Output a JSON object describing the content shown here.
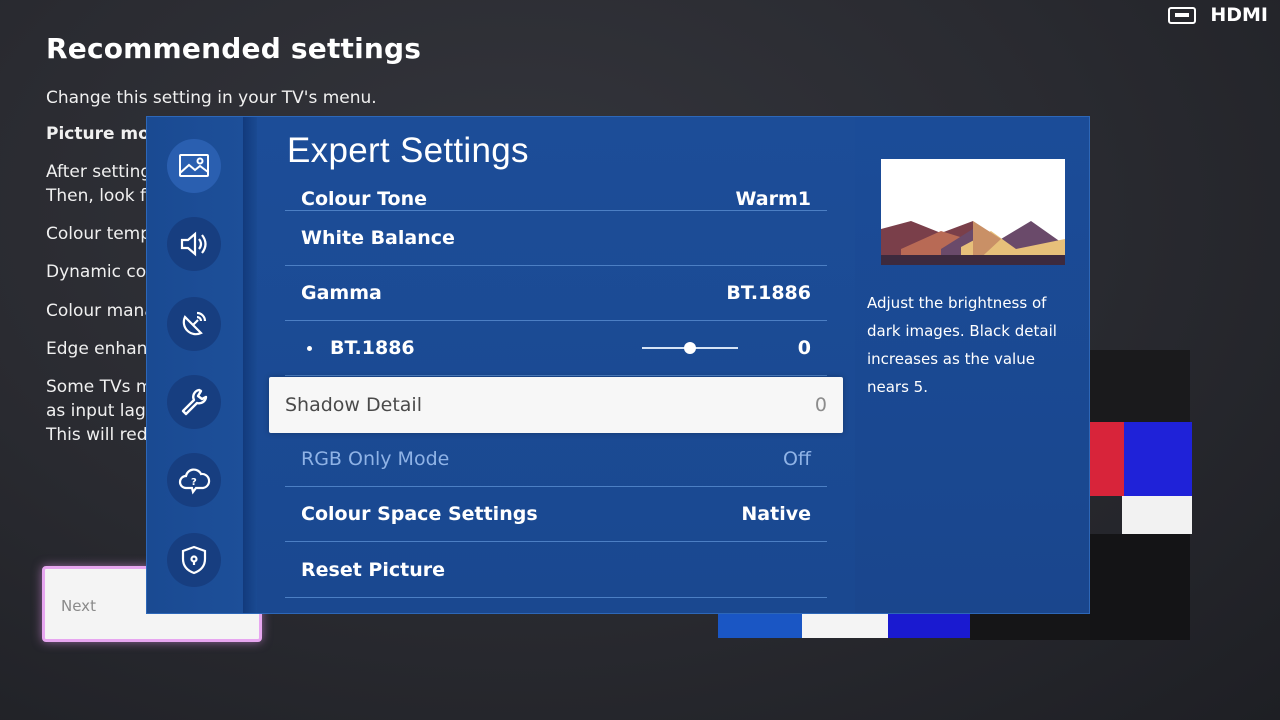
{
  "background": {
    "title": "Recommended settings",
    "lines": [
      {
        "text": "Change this setting in your TV's menu."
      },
      {
        "text": "Picture mod"
      },
      {
        "text": "After setting"
      },
      {
        "text": "Then, look fo"
      },
      {
        "text": "Colour temp"
      },
      {
        "text": "Dynamic co"
      },
      {
        "text": "Colour mana"
      },
      {
        "text": "Edge enhan"
      },
      {
        "text": "Some TVs m"
      },
      {
        "text": "as input lag."
      },
      {
        "text": "This will redu"
      }
    ],
    "next_button": "Next"
  },
  "input_source": {
    "icon": "hdmi-port-icon",
    "label": "HDMI"
  },
  "expert_settings": {
    "title": "Expert Settings",
    "rail_icons": [
      "picture-icon",
      "sound-icon",
      "broadcasting-icon",
      "general-wrench-icon",
      "support-cloud-icon",
      "privacy-shield-icon"
    ],
    "items": [
      {
        "label": "Colour Tone",
        "value": "Warm1"
      },
      {
        "label": "White Balance",
        "value": ""
      },
      {
        "label": "Gamma",
        "value": "BT.1886"
      },
      {
        "label": "BT.1886",
        "value": "0",
        "slider_level": 0.5
      },
      {
        "label": "Shadow Detail",
        "value": "0"
      },
      {
        "label": "RGB Only Mode",
        "value": "Off"
      },
      {
        "label": "Colour Space Settings",
        "value": "Native"
      },
      {
        "label": "Reset Picture",
        "value": ""
      }
    ],
    "description": "Adjust the brightness of dark images. Black detail increases as the value nears 5."
  },
  "colors": {
    "panel": "#1b4a92",
    "selected_row": "#f7f7f7",
    "next_border": "#e7a6f0"
  }
}
